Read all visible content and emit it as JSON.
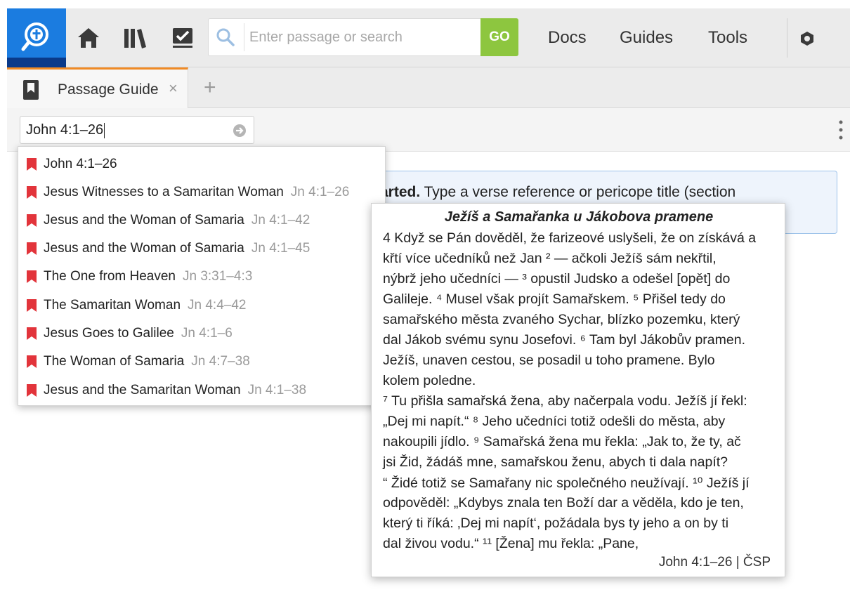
{
  "toolbar": {
    "search_placeholder": "Enter passage or search",
    "go_label": "GO",
    "nav": [
      "Docs",
      "Guides",
      "Tools"
    ],
    "accent": "#8dc63f",
    "logo_color": "#1b7ce0",
    "icons": [
      "app-logo-icon",
      "home-icon",
      "library-icon",
      "checklist-icon",
      "search-icon",
      "settings-icon"
    ]
  },
  "tabs": {
    "items": [
      {
        "label": "Passage Guide",
        "close": "×"
      }
    ],
    "add": "+",
    "active_border": "#f08a24"
  },
  "passage": {
    "value": "John 4:1–26"
  },
  "info": {
    "bold": "arted.",
    "text": " Type a verse reference or pericope title (section"
  },
  "suggestions": [
    {
      "title": "John 4:1–26",
      "ref": ""
    },
    {
      "title": "Jesus Witnesses to a Samaritan Woman",
      "ref": "Jn 4:1–26"
    },
    {
      "title": "Jesus and the Woman of Samaria",
      "ref": "Jn 4:1–42"
    },
    {
      "title": "Jesus and the Woman of Samaria",
      "ref": "Jn 4:1–45"
    },
    {
      "title": "The One from Heaven",
      "ref": "Jn 3:31–4:3"
    },
    {
      "title": "The Samaritan Woman",
      "ref": "Jn 4:4–42"
    },
    {
      "title": "Jesus Goes to Galilee",
      "ref": "Jn 4:1–6"
    },
    {
      "title": "The Woman of Samaria",
      "ref": "Jn 4:7–38"
    },
    {
      "title": "Jesus and the Samaritan Woman",
      "ref": "Jn 4:1–38"
    }
  ],
  "preview": {
    "title": "Ježíš a Samařanka u Jákobova pramene",
    "lines": [
      "4 Když se Pán dověděl, že farizeové uslyšeli, že on získává a",
      "křtí více učedníků než Jan ² — ačkoli Ježíš sám nekřtil,",
      "nýbrž jeho učedníci — ³ opustil Judsko a odešel [opět] do",
      "Galileje. ⁴ Musel však projít Samařskem. ⁵ Přišel tedy do",
      "samařského města zvaného Sychar, blízko pozemku, který",
      "dal Jákob svému synu Josefovi. ⁶ Tam byl Jákobův pramen.",
      "Ježíš, unaven cestou, se posadil u toho pramene. Bylo",
      "kolem poledne.",
      "⁷ Tu přišla samařská žena, aby načerpala vodu. Ježíš jí řekl:",
      "„Dej mi napít.“ ⁸ Jeho učedníci totiž odešli do města, aby",
      "nakoupili jídlo. ⁹ Samařská žena mu řekla: „Jak to, že ty, ač",
      "jsi Žid, žádáš mne, samařskou ženu, abych ti dala napít?",
      "“ Židé totiž se Samařany nic společného neužívají. ¹⁰ Ježíš jí",
      "odpověděl: „Kdybys znala ten Boží dar a věděla, kdo je ten,",
      "který ti říká: ‚Dej mi napít‘, požádala bys ty jeho a on by ti",
      "dal živou vodu.“ ¹¹ [Žena] mu řekla: „Pane,"
    ],
    "footer": "John 4:1–26 |  ČSP"
  }
}
